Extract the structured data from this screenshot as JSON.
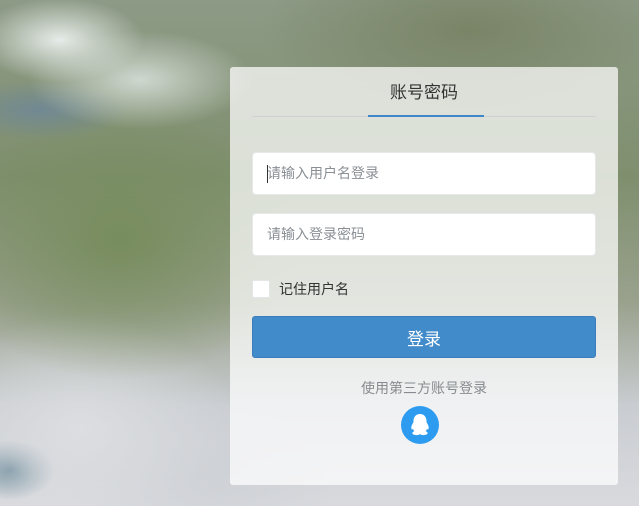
{
  "login": {
    "tab_label": "账号密码",
    "username_placeholder": "请输入用户名登录",
    "password_placeholder": "请输入登录密码",
    "remember_label": "记住用户名",
    "remember_checked": false,
    "submit_label": "登录",
    "third_party_label": "使用第三方账号登录",
    "third_party_icon": "qq-icon",
    "accent_color": "#428bca",
    "qq_color": "#2d9cf0"
  }
}
